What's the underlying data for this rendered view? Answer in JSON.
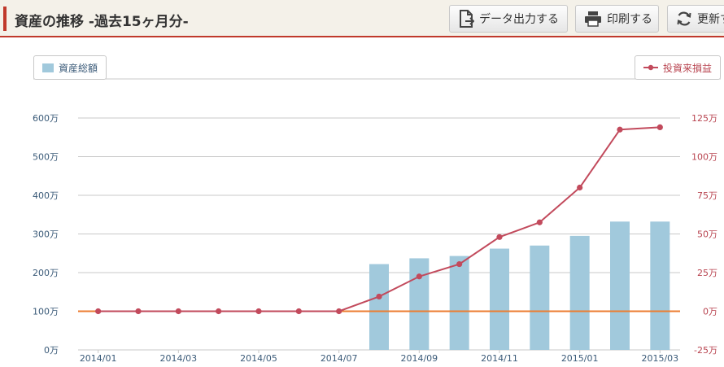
{
  "header": {
    "title": "資産の推移 -過去15ヶ月分-",
    "buttons": {
      "export_label": "データ出力する",
      "print_label": "印刷する",
      "refresh_label": "更新す"
    }
  },
  "legend": {
    "assets_label": "資産総額",
    "pnl_label": "投資来損益"
  },
  "colors": {
    "accent": "#c0392b",
    "bar": "#a1c9dc",
    "line": "#c24a5c",
    "baseline": "#ec7d31",
    "grid": "#c8c8c8",
    "left_axis_text": "#3a5a78",
    "right_axis_text": "#b8434f"
  },
  "chart_data": {
    "type": "bar",
    "categories": [
      "2014/01",
      "2014/02",
      "2014/03",
      "2014/04",
      "2014/05",
      "2014/06",
      "2014/07",
      "2014/08",
      "2014/09",
      "2014/10",
      "2014/11",
      "2014/12",
      "2015/01",
      "2015/02",
      "2015/03"
    ],
    "x_tick_labels": [
      "2014/01",
      "2014/03",
      "2014/05",
      "2014/07",
      "2014/09",
      "2014/11",
      "2015/01",
      "2015/03"
    ],
    "left_axis": {
      "ticks": [
        "0万",
        "100万",
        "200万",
        "300万",
        "400万",
        "500万",
        "600万"
      ],
      "ylim": [
        0,
        600
      ]
    },
    "right_axis": {
      "ticks": [
        "-25万",
        "0万",
        "25万",
        "50万",
        "75万",
        "100万",
        "125万"
      ],
      "ylim": [
        -25,
        125
      ]
    },
    "series": [
      {
        "name": "資産総額",
        "kind": "bar",
        "axis": "left",
        "values": [
          0,
          0,
          0,
          0,
          0,
          0,
          0,
          222,
          237,
          243,
          262,
          270,
          295,
          332,
          332
        ]
      },
      {
        "name": "投資来損益",
        "kind": "line",
        "axis": "right",
        "values": [
          0,
          0,
          0,
          0,
          0,
          0,
          0,
          9.5,
          22.5,
          30.5,
          48,
          57.5,
          80,
          117.5,
          119
        ]
      }
    ],
    "baseline_value_right": 0,
    "grid": true
  }
}
